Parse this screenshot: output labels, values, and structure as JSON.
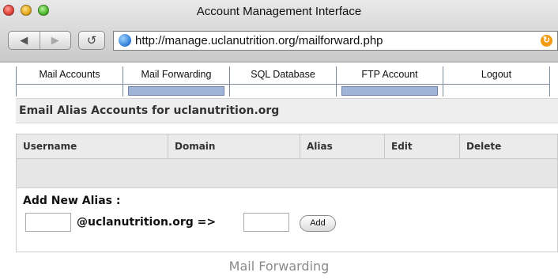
{
  "window": {
    "title": "Account Management Interface",
    "url": "http://manage.uclanutrition.org/mailforward.php",
    "back_glyph": "◀",
    "forward_glyph": "▶",
    "reload_glyph": "↺",
    "rss_glyph": "↻"
  },
  "tabs": [
    {
      "label": "Mail Accounts",
      "active": false
    },
    {
      "label": "Mail Forwarding",
      "active": true
    },
    {
      "label": "SQL Database",
      "active": false
    },
    {
      "label": "FTP Account",
      "active": true
    },
    {
      "label": "Logout",
      "active": false
    }
  ],
  "section": {
    "title": "Email Alias Accounts for uclanutrition.org"
  },
  "table": {
    "columns": [
      "Username",
      "Domain",
      "Alias",
      "Edit",
      "Delete"
    ],
    "rows": []
  },
  "add_alias": {
    "title": "Add New Alias :",
    "alias_value": "",
    "domain_label": "@uclanutrition.org =>",
    "target_value": "",
    "button_label": "Add"
  },
  "caption": "Mail Forwarding",
  "colors": {
    "active_tab_fill": "#a0b4d8",
    "header_bg": "#eeeeee"
  }
}
